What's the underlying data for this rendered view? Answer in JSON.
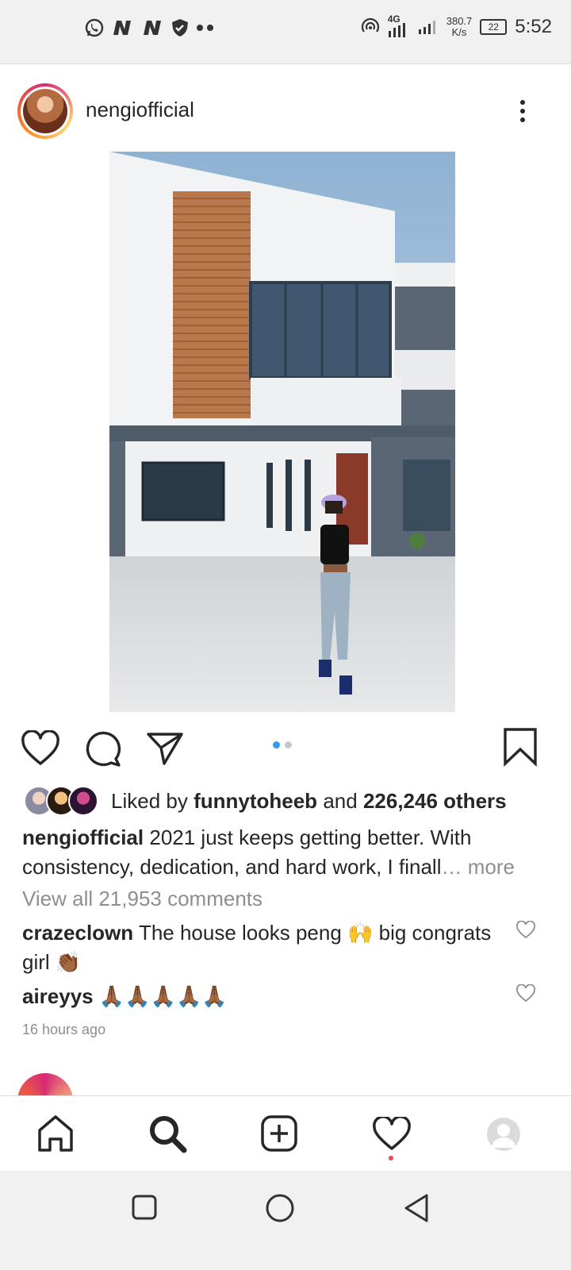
{
  "status_bar": {
    "time": "5:52",
    "network_speed_value": "380.7",
    "network_speed_unit": "K/s",
    "battery_level": "22",
    "network_type": "4G",
    "icons": [
      "whatsapp-icon",
      "n-app-icon",
      "n-app-icon",
      "shield-icon",
      "more-dots-icon",
      "hotspot-icon",
      "signal-icon",
      "battery-icon"
    ]
  },
  "post": {
    "username": "nengiofficial",
    "carousel": {
      "count": 2,
      "active_index": 0
    },
    "likes": {
      "prefix": "Liked by",
      "liker": "funnytoheeb",
      "connector": "and",
      "others": "226,246 others"
    },
    "caption": {
      "username": "nengiofficial",
      "text": "2021 just keeps getting better. With consistency, dedication, and hard work, I finall",
      "ellipsis": "…",
      "more": "more"
    },
    "view_all_comments": "View all 21,953 comments",
    "comments": [
      {
        "username": "crazeclown",
        "text": "The house looks peng 🙌 big congrats girl 👏🏾"
      },
      {
        "username": "aireyys",
        "text": "🙏🏾🙏🏾🙏🏾🙏🏾🙏🏾"
      }
    ],
    "time_ago": "16 hours ago"
  },
  "colors": {
    "accent_blue": "#3897f0",
    "notification_red": "#ed4956",
    "text_primary": "#262626",
    "text_muted": "#8e8e8e"
  }
}
